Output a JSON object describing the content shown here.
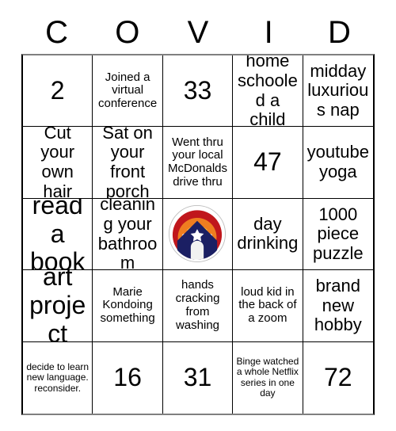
{
  "card": {
    "title_letters": [
      "C",
      "O",
      "V",
      "I",
      "D"
    ],
    "colors": {
      "text": "#000000",
      "grid_line": "#000000",
      "logo_outer_arc": "#c0171c",
      "logo_mid_arc": "#ef7e20",
      "logo_inner_arc": "#fbc33d",
      "logo_building": "#1b1f63",
      "logo_door": "#f1f1f1",
      "logo_star": "#ffffff",
      "logo_background": "#ffffff"
    },
    "rows": [
      [
        {
          "text": "2",
          "size": "xl"
        },
        {
          "text": "Joined a virtual conference",
          "size": "md"
        },
        {
          "text": "33",
          "size": "xl"
        },
        {
          "text": "home schooled a child",
          "size": "lg"
        },
        {
          "text": "midday luxurious nap",
          "size": "lg"
        }
      ],
      [
        {
          "text": "Cut your own hair",
          "size": "lg"
        },
        {
          "text": "Sat on your front porch",
          "size": "lg"
        },
        {
          "text": "Went thru your local McDonalds drive thru",
          "size": "md"
        },
        {
          "text": "47",
          "size": "xl"
        },
        {
          "text": "youtube yoga",
          "size": "lg"
        }
      ],
      [
        {
          "text": "read a book",
          "size": "xl"
        },
        {
          "text": "cleaning your bathroom",
          "size": "lg"
        },
        {
          "text": "",
          "size": "md",
          "free_space": true,
          "icon": "synagogue-logo-icon"
        },
        {
          "text": "day drinking",
          "size": "lg"
        },
        {
          "text": "1000 piece puzzle",
          "size": "lg"
        }
      ],
      [
        {
          "text": "art project",
          "size": "xl"
        },
        {
          "text": "Marie Kondoing something",
          "size": "md"
        },
        {
          "text": "hands cracking from washing",
          "size": "md"
        },
        {
          "text": "loud kid in the back of a zoom",
          "size": "md"
        },
        {
          "text": "brand new hobby",
          "size": "lg"
        }
      ],
      [
        {
          "text": "decide to learn new language. reconsider.",
          "size": "sm"
        },
        {
          "text": "16",
          "size": "xl"
        },
        {
          "text": "31",
          "size": "xl"
        },
        {
          "text": "Binge watched a whole Netflix series in one day",
          "size": "sm"
        },
        {
          "text": "72",
          "size": "xl"
        }
      ]
    ]
  }
}
